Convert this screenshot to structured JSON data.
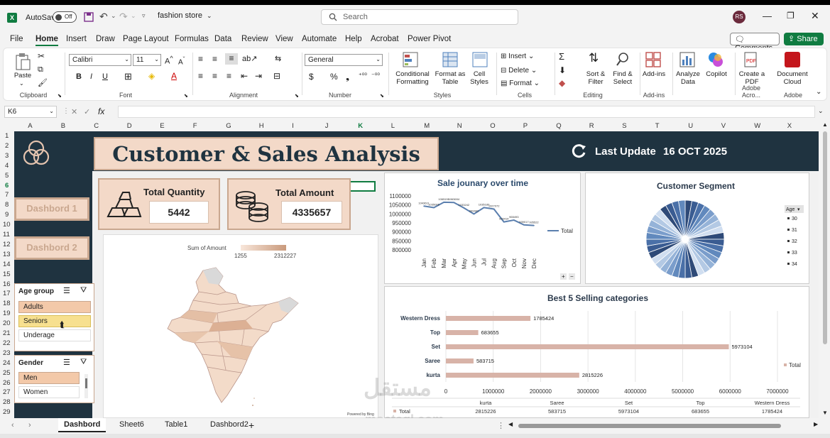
{
  "titlebar": {
    "autosave_label": "AutoSave",
    "autosave_state": "Off",
    "filename": "fashion store",
    "search_placeholder": "Search",
    "user_initials": "RS"
  },
  "menu": {
    "tabs": [
      "File",
      "Home",
      "Insert",
      "Draw",
      "Page Layout",
      "Formulas",
      "Data",
      "Review",
      "View",
      "Automate",
      "Help",
      "Acrobat",
      "Power Pivot"
    ],
    "active": "Home",
    "comments_label": "Comments",
    "share_label": "Share"
  },
  "ribbon": {
    "clipboard": {
      "paste": "Paste",
      "label": "Clipboard"
    },
    "font": {
      "name": "Calibri",
      "size": "11",
      "label": "Font"
    },
    "alignment": {
      "label": "Alignment"
    },
    "number": {
      "format": "General",
      "label": "Number"
    },
    "styles": {
      "conditional": "Conditional Formatting",
      "format_table": "Format as Table",
      "cell_styles": "Cell Styles",
      "label": "Styles"
    },
    "cells": {
      "insert": "Insert",
      "delete": "Delete",
      "format": "Format",
      "label": "Cells"
    },
    "editing": {
      "sort": "Sort & Filter",
      "find": "Find & Select",
      "label": "Editing"
    },
    "addins": {
      "addins": "Add-ins",
      "label": "Add-ins"
    },
    "analyze": {
      "analyze": "Analyze Data",
      "copilot": "Copilot"
    },
    "adobe": {
      "create": "Create a PDF",
      "cloud": "Document Cloud",
      "label_acro": "Adobe Acro...",
      "label": "Adobe"
    }
  },
  "formula_bar": {
    "cell_ref": "K6",
    "fx": "fx"
  },
  "columns": [
    "A",
    "B",
    "C",
    "D",
    "E",
    "F",
    "G",
    "H",
    "I",
    "J",
    "K",
    "L",
    "M",
    "N",
    "O",
    "P",
    "Q",
    "R",
    "S",
    "T",
    "U",
    "V",
    "W",
    "X"
  ],
  "rows": [
    "1",
    "2",
    "3",
    "4",
    "5",
    "6",
    "7",
    "8",
    "9",
    "10",
    "11",
    "12",
    "13",
    "14",
    "15",
    "16",
    "17",
    "18",
    "19",
    "20",
    "21",
    "22",
    "23",
    "24",
    "25",
    "26",
    "27",
    "28",
    "29"
  ],
  "dashboard": {
    "title": "Customer & Sales Analysis",
    "last_update_label": "Last Update",
    "last_update_date": "16 OCT 2025",
    "nav_buttons": [
      "Dashbord 1",
      "Dashbord 2"
    ],
    "kpis": [
      {
        "label": "Total Quantity",
        "value": "5442"
      },
      {
        "label": "Total Amount",
        "value": "4335657"
      }
    ],
    "slicers": [
      {
        "title": "Age group",
        "items": [
          "Adults",
          "Seniors",
          "Underage"
        ],
        "selected": [
          "Adults",
          "Seniors"
        ]
      },
      {
        "title": "Gender",
        "items": [
          "Men",
          "Women"
        ],
        "selected": [
          "Men"
        ]
      }
    ],
    "map": {
      "legend_title": "Sum of Amount",
      "min": "1255",
      "max": "2312227",
      "credit": "Powered by Bing"
    }
  },
  "chart_data": [
    {
      "type": "line",
      "title": "Sale jounary  over time",
      "x": [
        "Jan",
        "Feb",
        "Mar",
        "Apr",
        "May",
        "Jun",
        "Jul",
        "Aug",
        "Sep",
        "Oct",
        "Nov",
        "Dec"
      ],
      "series": [
        {
          "name": "Total",
          "values": [
            1043611,
            1035006,
            1065150,
            1063694,
            1033242,
            999483,
            1035189,
            1027072,
            955414,
            965493,
            939017,
            935522
          ]
        }
      ],
      "yticks": [
        "1100000",
        "1050000",
        "1000000",
        "950000",
        "900000",
        "850000",
        "800000"
      ],
      "ylim": [
        800000,
        1100000
      ],
      "data_labels": [
        "1043611",
        "1035006",
        "1065150",
        "1063694",
        "1033242",
        "999483",
        "1035189",
        "1027072",
        "955414",
        "965493",
        "939017",
        "935522"
      ],
      "legend": "right",
      "color": "#5b7fae"
    },
    {
      "type": "pie",
      "title": "Customer Segment",
      "legend_title": "Age",
      "legend_items": [
        "30",
        "31",
        "32",
        "33",
        "34"
      ],
      "slices": 36,
      "colors": [
        "#2e4a78",
        "#3a5c92",
        "#4a70a8",
        "#6189bd",
        "#7a9dcb",
        "#95b3d8",
        "#b3c9e4",
        "#d0def0"
      ]
    },
    {
      "type": "bar",
      "title": "Best 5 Selling categories",
      "categories": [
        "Western Dress",
        "Top",
        "Set",
        "Saree",
        "kurta"
      ],
      "values": [
        1785424,
        683655,
        5973104,
        583715,
        2815226
      ],
      "xticks": [
        "0",
        "1000000",
        "2000000",
        "3000000",
        "4000000",
        "5000000",
        "6000000",
        "7000000"
      ],
      "xlim": [
        0,
        7000000
      ],
      "legend": "Total",
      "color": "#d8b3a8",
      "table": {
        "headers": [
          "kurta",
          "Saree",
          "Set",
          "Top",
          "Western Dress"
        ],
        "row_label": "Total",
        "values": [
          "2815226",
          "583715",
          "5973104",
          "683655",
          "1785424"
        ]
      }
    }
  ],
  "sheet_tabs": {
    "tabs": [
      "Dashbord",
      "Sheet6",
      "Table1",
      "Dashbord2"
    ],
    "active": "Dashbord",
    "add": "+"
  },
  "watermark": {
    "arabic": "مستقل",
    "latin": "mostaql.com"
  },
  "colors": {
    "dark_panel": "#1f3340",
    "accent_peach": "#f3d9c8",
    "excel_green": "#107c41",
    "map_light": "#f5e0d2",
    "map_dark": "#cfa58a"
  }
}
